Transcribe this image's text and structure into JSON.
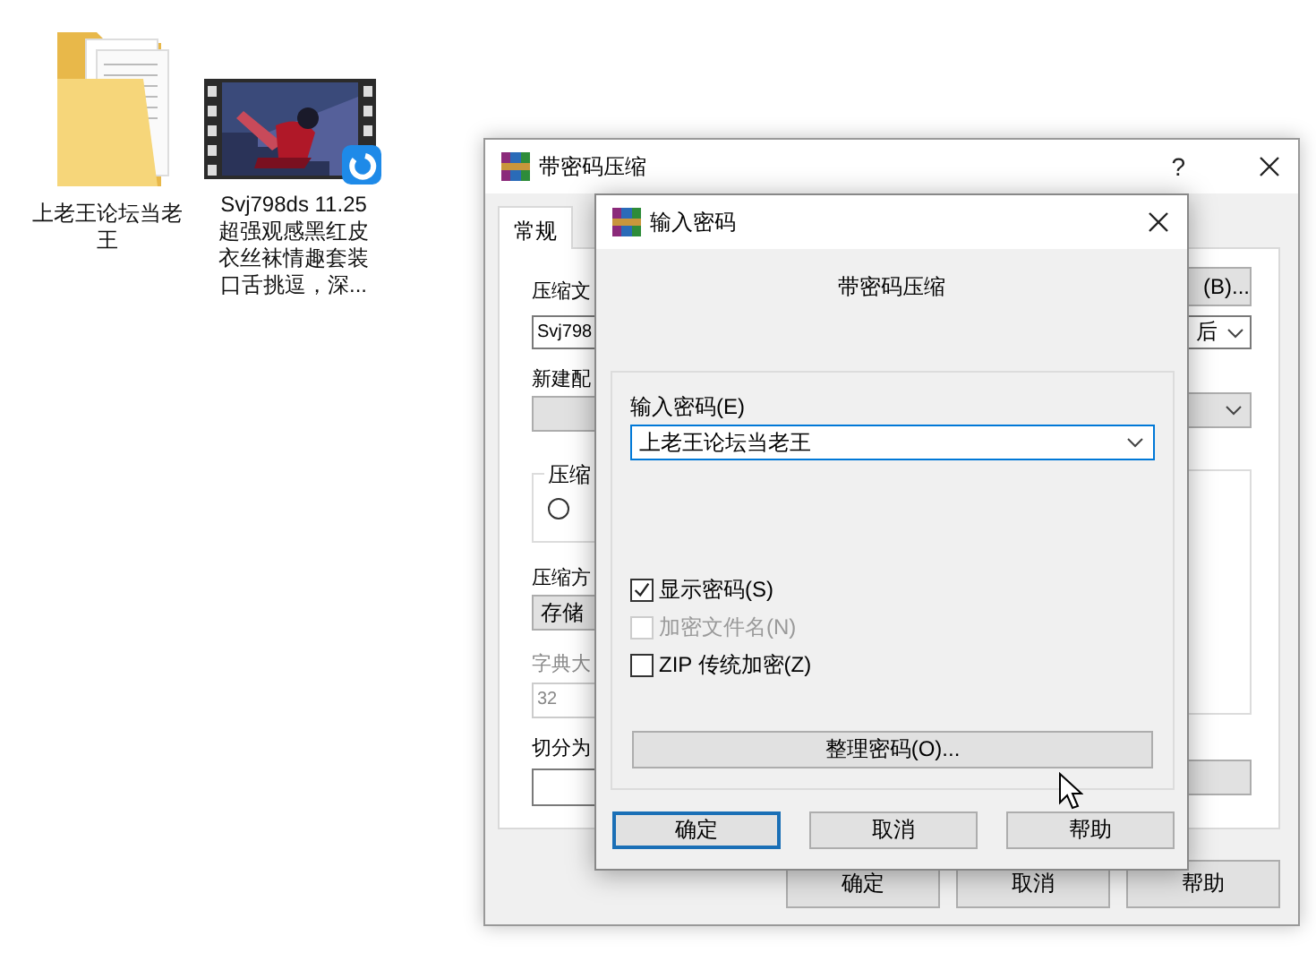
{
  "desktop": {
    "icons": [
      {
        "kind": "folder",
        "label": "上老王论坛当老王"
      },
      {
        "kind": "video",
        "label": "Svj798ds 11.25 超强观感黑红皮衣丝袜情趣套装口舌挑逗，深..."
      }
    ]
  },
  "archive_dialog": {
    "title": "带密码压缩",
    "help": "?",
    "tabs": [
      {
        "label": "常规",
        "selected": true
      }
    ],
    "archive_name_label": "压缩文",
    "archive_name_value": "Svj798",
    "browse_button": "(B)...",
    "update_mode_value": "后",
    "profile_label": "新建配",
    "format_group_label": "压缩",
    "format_radio": {
      "selected": false
    },
    "method_label": "压缩方",
    "method_value": "存储",
    "dictionary": {
      "label": "字典大",
      "value": "32",
      "disabled": true
    },
    "split_label": "切分为",
    "buttons": [
      {
        "label": "确定"
      },
      {
        "label": "取消"
      },
      {
        "label": "帮助"
      }
    ]
  },
  "password_dialog": {
    "title": "输入密码",
    "heading": "带密码压缩",
    "password_label": "输入密码(E)",
    "password_value": "上老王论坛当老王",
    "options": [
      {
        "label": "显示密码(S)",
        "checked": true,
        "disabled": false
      },
      {
        "label": "加密文件名(N)",
        "checked": false,
        "disabled": true
      },
      {
        "label": "ZIP 传统加密(Z)",
        "checked": false,
        "disabled": false
      }
    ],
    "organize_button": "整理密码(O)...",
    "buttons": [
      {
        "label": "确定",
        "default": true
      },
      {
        "label": "取消",
        "default": false
      },
      {
        "label": "帮助",
        "default": false
      }
    ]
  }
}
